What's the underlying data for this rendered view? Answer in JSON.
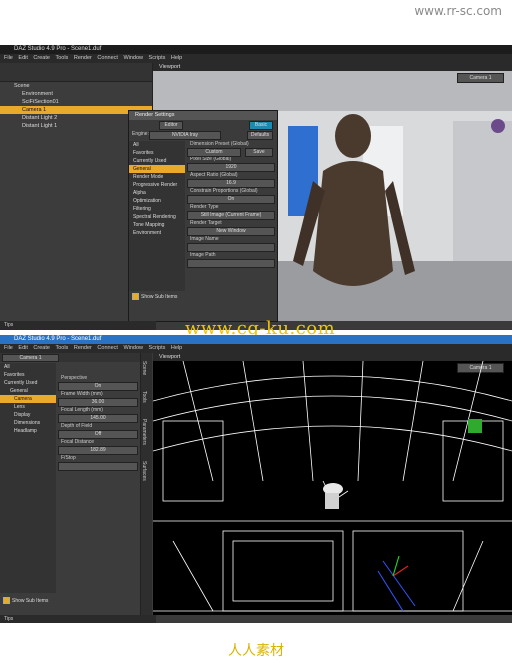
{
  "watermarks": {
    "top": "www.rr-sc.com",
    "middle": "www.cg-ku.com",
    "bottom": "人人素材"
  },
  "colors": {
    "accent": "#e9a92a",
    "titlebar_active": "#2a73c4",
    "viewport_bg": "#6a6a6a",
    "panel_bg": "#3c3c3c"
  },
  "top_window": {
    "title": "DAZ Studio 4.9 Pro - Scene1.duf",
    "menu": [
      "File",
      "Edit",
      "Create",
      "Tools",
      "Render",
      "Connect",
      "Window",
      "Scripts",
      "Help"
    ],
    "scene_tree": [
      {
        "label": "Scene",
        "selected": false
      },
      {
        "label": "Environment",
        "selected": false
      },
      {
        "label": "SciFiSection01",
        "selected": false
      },
      {
        "label": "Camera 1",
        "selected": true
      },
      {
        "label": "Distant Light 2",
        "selected": false
      },
      {
        "label": "Distant Light 1",
        "selected": false
      }
    ],
    "viewport_tab": "Viewport",
    "camera_dropdown": "Camera 1",
    "render_dialog": {
      "title": "Render Settings",
      "engine_label": "Engine:",
      "engine_value": "NVIDIA Iray",
      "defaults_button": "Defaults",
      "tabs": [
        "Editor",
        "Basic"
      ],
      "categories": [
        "All",
        "Favorites",
        "Currently Used",
        "General",
        "Render Mode",
        "Progressive Render",
        "Alpha",
        "Optimization",
        "Filtering",
        "Spectral Rendering",
        "Tone Mapping",
        "Environment"
      ],
      "selected_category": "General",
      "show_sub_items": "Show Sub Items",
      "properties": [
        {
          "label": "Dimension Preset (Global)",
          "value": "Custom"
        },
        {
          "label": "Pixel Size (Global)",
          "value": "1920"
        },
        {
          "label": "Aspect Ratio (Global)",
          "value": "16.9"
        },
        {
          "label": "Constrain Proportions (Global)",
          "value": "On"
        },
        {
          "label": "Render Type",
          "value": "Still Image (Current Frame)"
        },
        {
          "label": "Render Target",
          "value": "New Window"
        },
        {
          "label": "Image Name",
          "value": ""
        },
        {
          "label": "Image Path",
          "value": ""
        }
      ],
      "save_button": "Save"
    },
    "tips_tab": "Tips"
  },
  "bottom_window": {
    "title": "DAZ Studio 4.9 Pro - Scene1.duf",
    "menu": [
      "File",
      "Edit",
      "Create",
      "Tools",
      "Render",
      "Connect",
      "Window",
      "Scripts",
      "Help"
    ],
    "camera_dropdown": "Camera 1",
    "categories": [
      "All",
      "Favorites",
      "Currently Used",
      "General",
      "Camera",
      "Lens",
      "Display",
      "Dimensions",
      "Headlamp"
    ],
    "selected_category": "Camera",
    "properties": [
      {
        "label": "Perspective",
        "value": "On"
      },
      {
        "label": "Frame Width (mm)",
        "value": "36.00"
      },
      {
        "label": "Focal Length (mm)",
        "value": "145.00"
      },
      {
        "label": "Depth of Field",
        "value": "Off"
      },
      {
        "label": "Focal Distance",
        "value": "182.89"
      },
      {
        "label": "F/Stop",
        "value": ""
      }
    ],
    "show_sub_items": "Show Sub Items",
    "viewport_tab": "Viewport",
    "viewport_camera": "Camera 1",
    "side_tabs": [
      "Scene",
      "Tools",
      "Parameters",
      "Surfaces"
    ],
    "tips_tab": "Tips"
  }
}
